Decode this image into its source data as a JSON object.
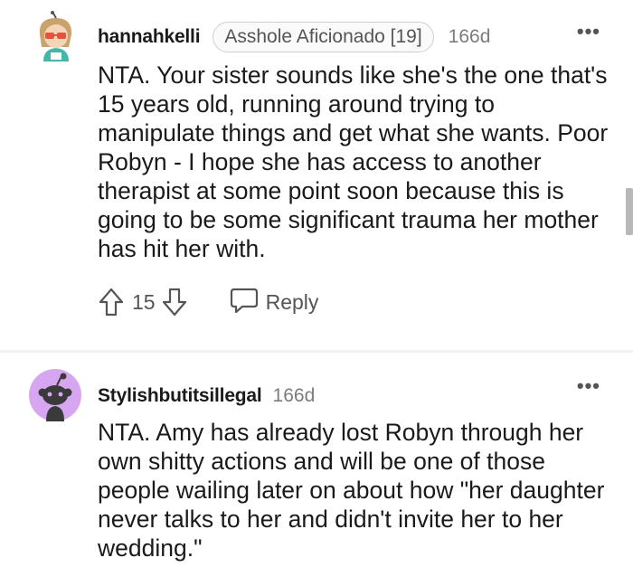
{
  "comments": [
    {
      "username": "hannahkelli",
      "flair": "Asshole Aficionado [19]",
      "age": "166d",
      "more_label": "•••",
      "text": "NTA. Your sister sounds like she's the one that's 15 years old, running around trying to manipulate things and get what she wants. Poor Robyn - I hope she has access to another therapist at some point soon because this is going to be some significant trauma her mother has hit her with.",
      "score": "15",
      "reply_label": "Reply"
    },
    {
      "username": "Stylishbutitsillegal",
      "age": "166d",
      "more_label": "•••",
      "text": "NTA. Amy has already lost Robyn through her own shitty actions and will be one of those people wailing later on about how \"her daughter never talks to her and didn't invite her to her wedding.\""
    }
  ],
  "colors": {
    "text": "#1a1a1b",
    "muted": "#7c7c7c",
    "avatar_bg": "#d7a6f0",
    "divider": "#f2f2f2"
  },
  "icons": [
    "user-avatar-icon",
    "snoo-avatar-icon",
    "upvote-icon",
    "downvote-icon",
    "reply-icon",
    "more-options-icon"
  ]
}
